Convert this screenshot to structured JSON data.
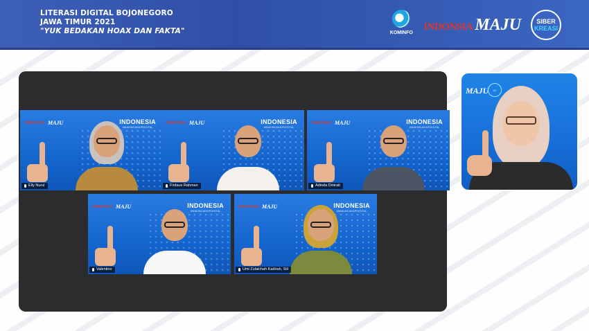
{
  "header": {
    "title_line1": "LITERASI DIGITAL BOJONEGORO",
    "title_line2": "JAWA TIMUR 2021",
    "title_line3": "\"YUK BEDAKAN HOAX DAN FAKTA\"",
    "logo_kominfo": "KOMINFO",
    "logo_indonesia": "INDONSIA",
    "logo_maju": "MAJU",
    "logo_siber_line1": "SIBER",
    "logo_siber_line2": "KREASI"
  },
  "tile_branding": {
    "left_red": "INDONSIA",
    "left_white": "MAJU",
    "right_big": "INDONESIA",
    "right_small": "#MAKINCAKAPDIGITAL"
  },
  "participants": [
    {
      "name": "Elly Nurul",
      "hijab_color": "#c7c2bd",
      "shirt_color": "#b88a3d"
    },
    {
      "name": "Firdaus Rahman",
      "hijab_color": "",
      "shirt_color": "#f4f1ec"
    },
    {
      "name": "Adinda Dinirati",
      "hijab_color": "",
      "shirt_color": "#4b5563"
    },
    {
      "name": "Valentino",
      "hijab_color": "",
      "shirt_color": "#f7f7f7"
    },
    {
      "name": "Umi Zulaichah Kadirah, SH",
      "hijab_color": "#c9a23a",
      "shirt_color": "#7b8a3c"
    }
  ],
  "presenter": {
    "maju": "MAJU",
    "hijab_color": "#e8cfc3",
    "shirt_color": "#2b2b2b"
  },
  "colors": {
    "header_bg": "#3656b0",
    "meeting_bg": "#2c2c2e",
    "tile_bg": "#1a6fd8",
    "accent_red": "#e0352b"
  }
}
